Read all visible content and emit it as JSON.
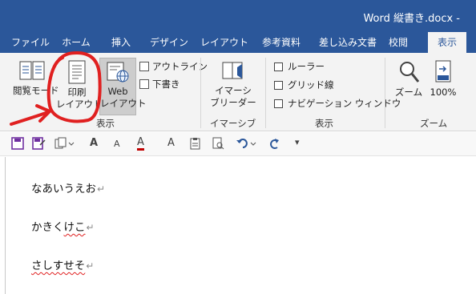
{
  "window": {
    "title": "Word 縦書き.docx  -"
  },
  "tabs": [
    {
      "label": "ファイル",
      "active": false
    },
    {
      "label": "ホーム",
      "active": false
    },
    {
      "label": "挿入",
      "active": false
    },
    {
      "label": "デザイン",
      "active": false
    },
    {
      "label": "レイアウト",
      "active": false
    },
    {
      "label": "参考資料",
      "active": false
    },
    {
      "label": "差し込み文書",
      "active": false
    },
    {
      "label": "校閲",
      "active": false
    },
    {
      "label": "表示",
      "active": true
    }
  ],
  "ribbon": {
    "views": {
      "read_mode": "閲覧モード",
      "print_layout_1": "印刷",
      "print_layout_2": "レイアウト",
      "web_layout_1": "Web",
      "web_layout_2": "レイアウト",
      "outline": "アウトライン",
      "draft": "下書き",
      "group_label": "表示"
    },
    "immersive": {
      "reader_1": "イマーシ",
      "reader_2": "ブリーダー",
      "group_label": "イマーシブ"
    },
    "show": {
      "ruler": "ルーラー",
      "gridlines": "グリッド線",
      "nav_pane": "ナビゲーション ウィンドウ",
      "group_label": "表示"
    },
    "zoom": {
      "zoom": "ズーム",
      "percent": "100%",
      "group_label": "ズーム"
    }
  },
  "qat": {
    "icons": [
      "save-icon",
      "save-as-icon",
      "copy-icon",
      "font-grow-icon",
      "font-shrink-icon",
      "font-color-icon",
      "clear-format-icon",
      "paste-special-icon",
      "print-preview-icon",
      "undo-icon",
      "redo-icon",
      "customize-icon"
    ],
    "glyphs": {
      "grow": "A",
      "shrink": "A",
      "color": "A",
      "clear": "A",
      "more": "▾"
    }
  },
  "document": {
    "lines": [
      {
        "plain": "なあいうえお",
        "squiggle_part": "",
        "mark": "↵"
      },
      {
        "plain": "かきく",
        "squiggle_part": "けこ",
        "mark": "↵"
      },
      {
        "plain": "",
        "squiggle_part": "さしすせそ",
        "mark": "↵"
      }
    ]
  },
  "colors": {
    "accent": "#2b579a",
    "ribbon_bg": "#f3f3f3",
    "annotation": "#e02020",
    "font_color_bar": "#c00000"
  }
}
